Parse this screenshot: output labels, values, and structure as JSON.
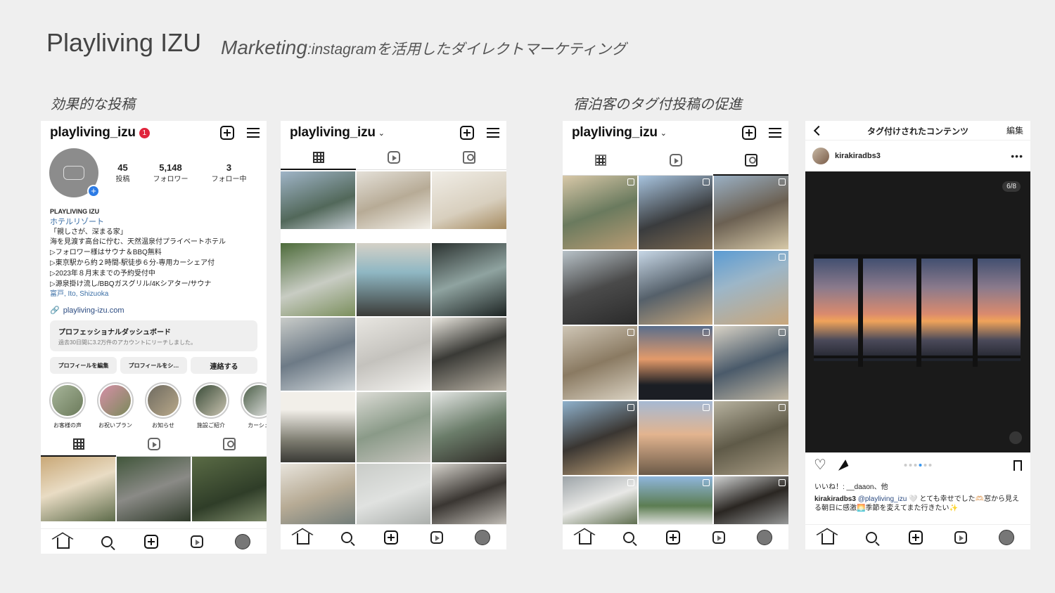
{
  "slide": {
    "title": "Playliving IZU",
    "subtitle_main": "Marketing",
    "subtitle_rest": ":instagramを活用したダイレクトマーケティング",
    "section_left": "効果的な投稿",
    "section_right": "宿泊客のタグ付投稿の促進"
  },
  "colors": {
    "badge": "#e0243b",
    "link": "#3a6ea5",
    "pager_active": "#3897f0"
  },
  "profile": {
    "handle": "playliving_izu",
    "notif_count": "1",
    "avatar_plus": "+",
    "stats": [
      {
        "value": "45",
        "label": "投稿"
      },
      {
        "value": "5,148",
        "label": "フォロワー"
      },
      {
        "value": "3",
        "label": "フォロー中"
      }
    ],
    "bio": {
      "name": "PLAYLIVING IZU",
      "category": "ホテルリゾート",
      "lines": [
        "「親しさが、深まる家」",
        "海を見渡す高台に佇む、天然温泉付プライベートホテル",
        "▷フォロワー様はサウナ＆BBQ無料",
        "▷東京駅から約２時間-駅徒歩６分-専用カーシェア付",
        "▷2023年８月末までの予約受付中",
        "▷源泉掛け流し/BBQガスグリル/4Kシアター/サウナ"
      ],
      "location": "富戸, Ito, Shizuoka"
    },
    "website": "playliving-izu.com",
    "dashboard_title": "プロフェッショナルダッシュボード",
    "dashboard_sub": "過去30日間に3.2万件のアカウントにリーチしました。",
    "buttons": [
      "プロフィールを編集",
      "プロフィールをシ…",
      "連絡する"
    ],
    "highlights": [
      "お客様の声",
      "お祝いプラン",
      "お知らせ",
      "施設ご紹介",
      "カーシェ"
    ]
  },
  "grid_handle": "playliving_izu",
  "tagged_handle": "playliving_izu",
  "chevron": "⌄",
  "post": {
    "header_title": "タグ付けされたコンテンツ",
    "edit": "編集",
    "username": "kirakiradbs3",
    "more": "•••",
    "counter": "6/8",
    "likes": "いいね！: __daaon、他",
    "caption_user": "kirakiradbs3",
    "caption_mention": "@playliving_izu",
    "caption_text": "🤍 とても幸せでした🫶🏻窓から見える朝日に感激🌅季節を変えてまた行きたい✨"
  },
  "icons": [
    "plus-square-icon",
    "menu-icon",
    "grid-icon",
    "reels-icon",
    "tagged-icon",
    "home-icon",
    "search-icon",
    "create-icon",
    "avatar-icon",
    "heart-icon",
    "send-icon",
    "bookmark-icon",
    "back-icon",
    "link-icon",
    "mute-icon"
  ]
}
